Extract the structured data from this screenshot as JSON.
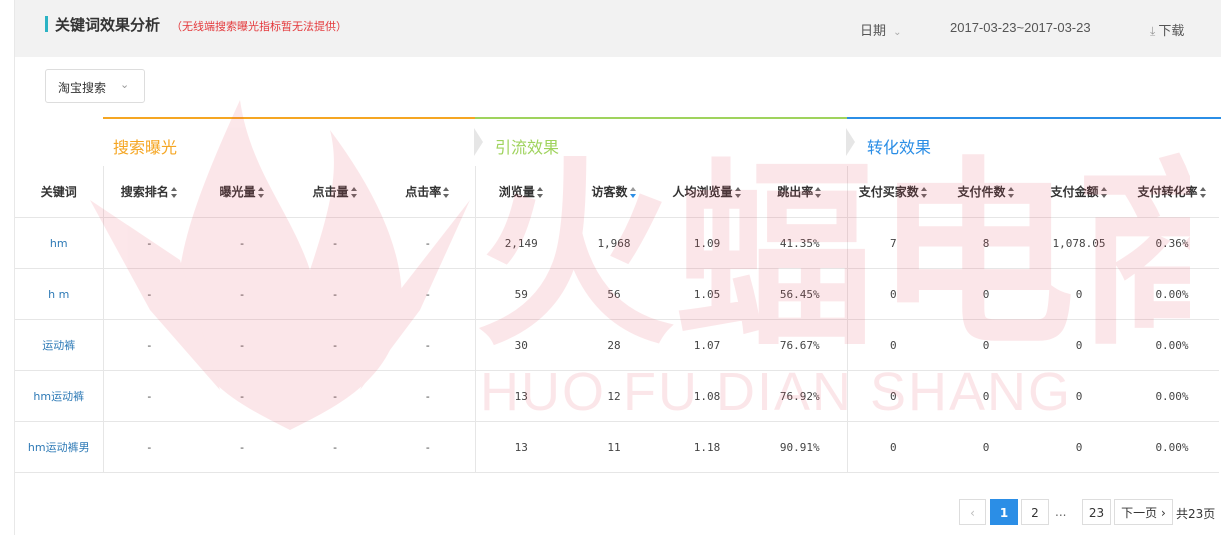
{
  "header": {
    "title": "关键词效果分析",
    "title_note": "（无线端搜索曝光指标暂无法提供）",
    "date_label": "日期",
    "date_range": "2017-03-23~2017-03-23",
    "download_label": "下载"
  },
  "filter": {
    "selected": "淘宝搜索"
  },
  "groups": [
    {
      "label": "搜索曝光",
      "color": "#f5a623"
    },
    {
      "label": "引流效果",
      "color": "#9fd35d"
    },
    {
      "label": "转化效果",
      "color": "#2b8ee6"
    }
  ],
  "columns": [
    "关键词",
    "搜索排名",
    "曝光量",
    "点击量",
    "点击率",
    "浏览量",
    "访客数",
    "人均浏览量",
    "跳出率",
    "支付买家数",
    "支付件数",
    "支付金额",
    "支付转化率"
  ],
  "rows": [
    [
      "hm",
      "-",
      "-",
      "-",
      "-",
      "2,149",
      "1,968",
      "1.09",
      "41.35%",
      "7",
      "8",
      "1,078.05",
      "0.36%"
    ],
    [
      "h m",
      "-",
      "-",
      "-",
      "-",
      "59",
      "56",
      "1.05",
      "56.45%",
      "0",
      "0",
      "0",
      "0.00%"
    ],
    [
      "运动裤",
      "-",
      "-",
      "-",
      "-",
      "30",
      "28",
      "1.07",
      "76.67%",
      "0",
      "0",
      "0",
      "0.00%"
    ],
    [
      "hm运动裤",
      "-",
      "-",
      "-",
      "-",
      "13",
      "12",
      "1.08",
      "76.92%",
      "0",
      "0",
      "0",
      "0.00%"
    ],
    [
      "hm运动裤男",
      "-",
      "-",
      "-",
      "-",
      "13",
      "11",
      "1.18",
      "90.91%",
      "0",
      "0",
      "0",
      "0.00%"
    ]
  ],
  "pagination": {
    "pages": [
      "1",
      "2",
      "23"
    ],
    "current": "1",
    "ellipsis": "...",
    "next_label": "下一页",
    "total_label": "共23页"
  },
  "watermark": {
    "text_cn": "火蝠电商",
    "text_en": "HUO FU DIAN SHANG",
    "color": "#e8475a"
  }
}
